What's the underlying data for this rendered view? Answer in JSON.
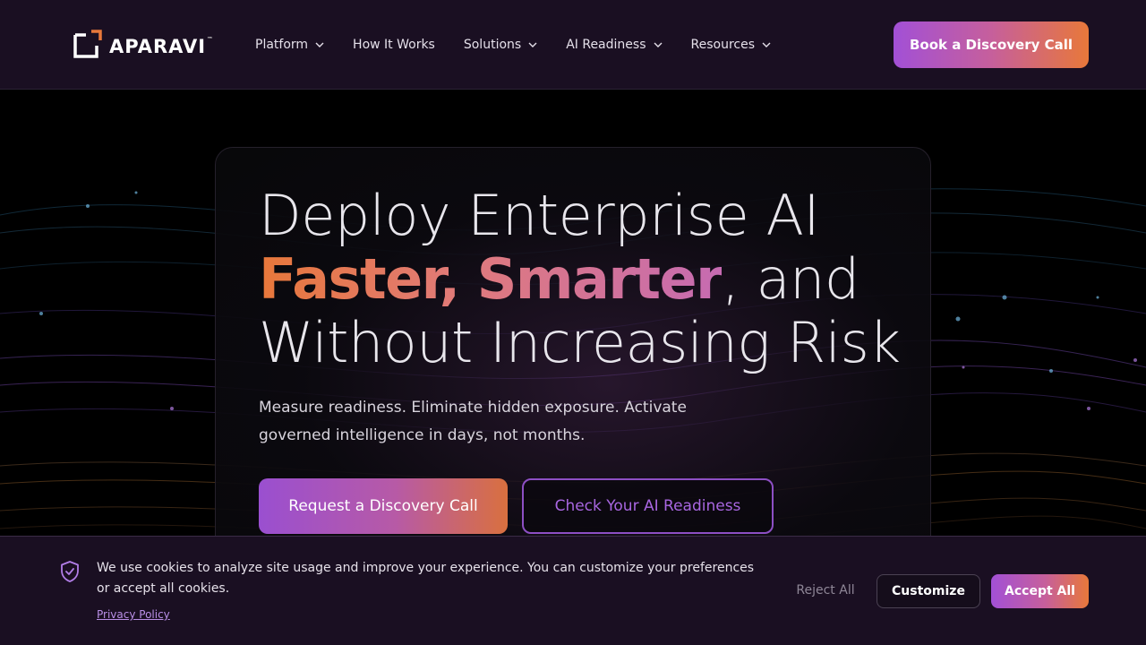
{
  "brand": {
    "name": "APARAVI",
    "trademark": "™",
    "logo_icon": "aparavi-logo-icon",
    "accent_orange": "#e8783a",
    "accent_purple": "#a250d6"
  },
  "nav": {
    "items": [
      {
        "label": "Platform",
        "has_dropdown": true
      },
      {
        "label": "How It Works",
        "has_dropdown": false
      },
      {
        "label": "Solutions",
        "has_dropdown": true
      },
      {
        "label": "AI Readiness",
        "has_dropdown": true
      },
      {
        "label": "Resources",
        "has_dropdown": true
      }
    ],
    "cta_label": "Book a Discovery Call"
  },
  "hero": {
    "line1": "Deploy Enterprise AI",
    "highlight": "Faster, Smarter",
    "line2_rest": ", and",
    "line3": "Without Increasing Risk",
    "subtext": "Measure readiness. Eliminate hidden exposure. Activate governed intelligence in days, not months.",
    "primary_cta": "Request a Discovery Call",
    "secondary_cta": "Check Your AI Readiness"
  },
  "cookie_banner": {
    "icon": "shield-check-icon",
    "message": "We use cookies to analyze site usage and improve your experience. You can customize your preferences or accept all cookies.",
    "privacy_link": "Privacy Policy",
    "reject_label": "Reject All",
    "customize_label": "Customize",
    "accept_label": "Accept All"
  }
}
